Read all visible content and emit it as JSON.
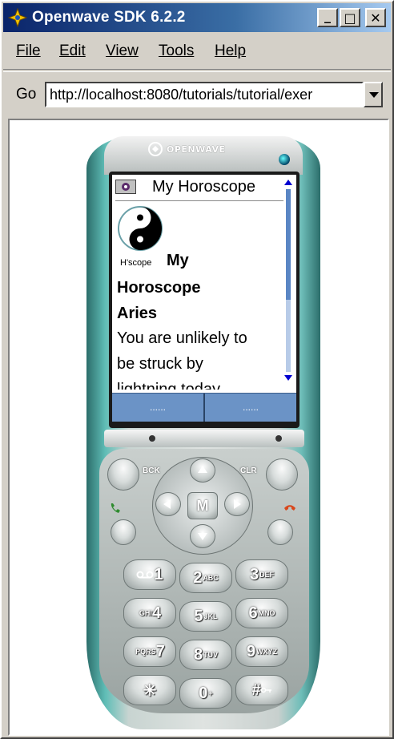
{
  "window": {
    "title": "Openwave SDK 6.2.2",
    "minimize": "_",
    "maximize": "□",
    "close": "✕"
  },
  "menu": {
    "file": "File",
    "edit": "Edit",
    "view": "View",
    "tools": "Tools",
    "help": "Help"
  },
  "gobar": {
    "label": "Go",
    "url": "http://localhost:8080/tutorials/tutorial/exer"
  },
  "phone": {
    "brand": "OPENWAVE",
    "screen": {
      "title": "My Horoscope",
      "image_label": "H'scope",
      "heading_part1": "My",
      "heading_part2": "Horoscope",
      "sign": "Aries",
      "text_line1": "You are unlikely to",
      "text_line2": "be struck by",
      "text_line3": "lightning today"
    },
    "softkeys": {
      "left": "......",
      "right": "......"
    },
    "keys": {
      "back": "BCK",
      "clear": "CLR",
      "menu": "M",
      "k1": "1",
      "k1_sub": "",
      "k2": "2",
      "k2_sub": "ABC",
      "k3": "3",
      "k3_sub": "DEF",
      "k4": "4",
      "k4_sub": "GHI",
      "k5": "5",
      "k5_sub": "JKL",
      "k6": "6",
      "k6_sub": "MNO",
      "k7": "7",
      "k7_sub": "PQRS",
      "k8": "8",
      "k8_sub": "TUV",
      "k9": "9",
      "k9_sub": "WXYZ",
      "kstar": "✳",
      "k0": "0",
      "k0_sub": "+",
      "khash": "#"
    }
  },
  "colors": {
    "titlebar_start": "#0a246a",
    "titlebar_end": "#a6caf0",
    "phone_teal": "#5fbdb6",
    "softkey_blue": "#6b93c6"
  }
}
